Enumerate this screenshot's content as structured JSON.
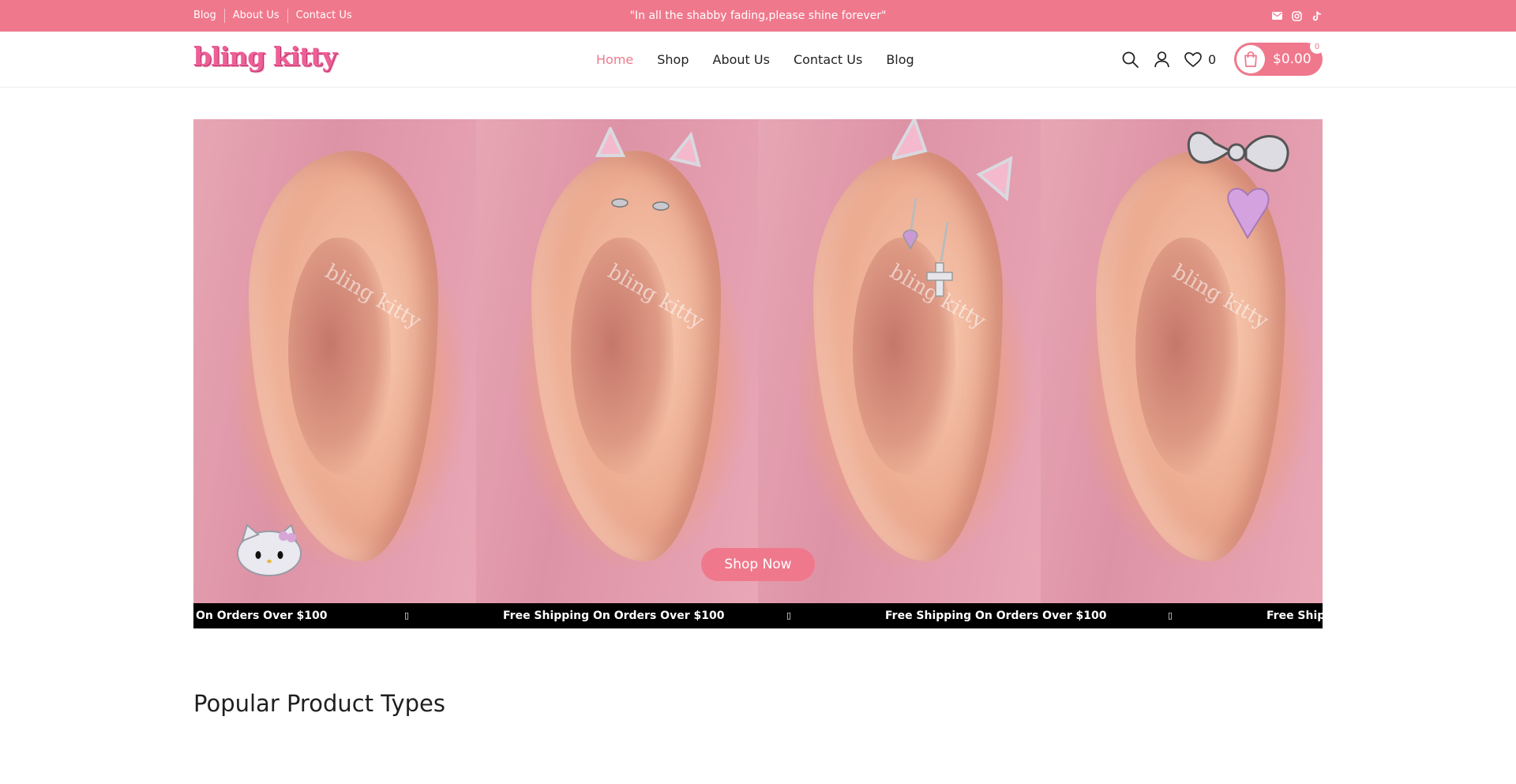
{
  "topbar": {
    "links": [
      "Blog",
      "About Us",
      "Contact Us"
    ],
    "quote": "\"In all the shabby fading,please shine forever\"",
    "socials": [
      "mail-icon",
      "instagram-icon",
      "tiktok-icon"
    ]
  },
  "header": {
    "logo": "bling kitty",
    "nav": [
      "Home",
      "Shop",
      "About Us",
      "Contact Us",
      "Blog"
    ],
    "active_nav": "Home",
    "wishlist_count": "0",
    "cart_total": "$0.00",
    "cart_count": "0"
  },
  "hero": {
    "watermark": "bling kitty",
    "shop_button": "Shop Now",
    "marquee": [
      "On Orders Over $100",
      "Free Shipping On Orders Over $100",
      "Free Shipping On Orders Over $100",
      "Free Shipp"
    ]
  },
  "section": {
    "title": "Popular Product Types"
  },
  "colors": {
    "brand_pink": "#f0788c",
    "active_nav": "#ee7a8d",
    "marquee_bg": "#000000"
  }
}
